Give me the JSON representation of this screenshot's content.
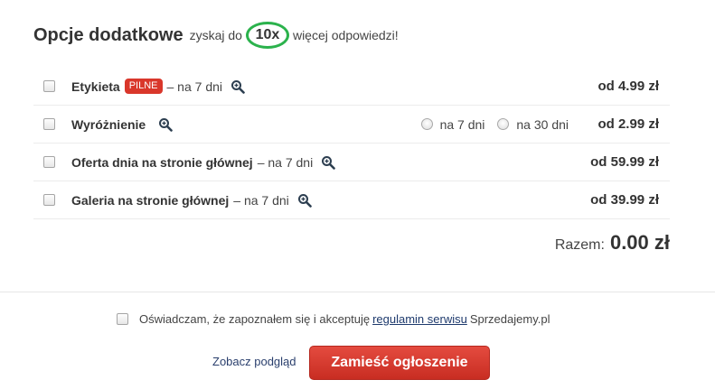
{
  "header": {
    "title": "Opcje dodatkowe",
    "sub_before": "zyskaj do",
    "badge": "10x",
    "sub_after": "więcej odpowiedzi!"
  },
  "options": [
    {
      "label": "Etykieta",
      "tag": "PILNE",
      "suffix": "– na 7 dni",
      "price": "od 4.99 zł"
    },
    {
      "label": "Wyróżnienie",
      "price": "od 2.99 zł",
      "radio_a": "na 7 dni",
      "radio_b": "na 30 dni"
    },
    {
      "label": "Oferta dnia na stronie głównej",
      "suffix": "– na 7 dni",
      "price": "od 59.99 zł"
    },
    {
      "label": "Galeria na stronie głównej",
      "suffix": "– na 7 dni",
      "price": "od 39.99 zł"
    }
  ],
  "total": {
    "label": "Razem:",
    "value": "0.00 zł"
  },
  "accept": {
    "before": "Oświadczam, że zapoznałem się i akceptuję",
    "link": "regulamin serwisu",
    "after": "Sprzedajemy.pl"
  },
  "actions": {
    "preview": "Zobacz podgląd",
    "submit": "Zamieść ogłoszenie"
  },
  "colors": {
    "accent": "#d9372b",
    "badge_ring": "#2bb24c",
    "link": "#1e3a6d"
  }
}
